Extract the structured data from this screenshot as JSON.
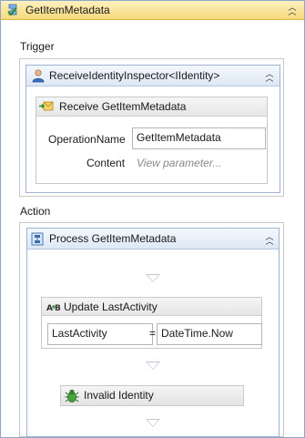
{
  "header": {
    "title": "GetItemMetadata",
    "collapse_icon": "double-chevron-up-icon"
  },
  "trigger": {
    "label": "Trigger",
    "inspector": {
      "title": "ReceiveIdentityInspector<IIdentity>",
      "receive": {
        "title": "Receive GetItemMetadata",
        "operation_label": "OperationName",
        "operation_value": "GetItemMetadata",
        "content_label": "Content",
        "content_placeholder": "View parameter..."
      }
    }
  },
  "action": {
    "label": "Action",
    "process": {
      "title": "Process GetItemMetadata",
      "assign": {
        "title": "Update LastActivity",
        "to_value": "LastActivity",
        "equals": "=",
        "from_value": "DateTime.Now"
      },
      "invalid": {
        "title": "Invalid Identity"
      }
    }
  },
  "colors": {
    "header_gold": "#f7d97a",
    "header_blue": "#dde8f5",
    "border_blue": "#8ea7c7",
    "arrow_gray": "#c3c9d3"
  }
}
